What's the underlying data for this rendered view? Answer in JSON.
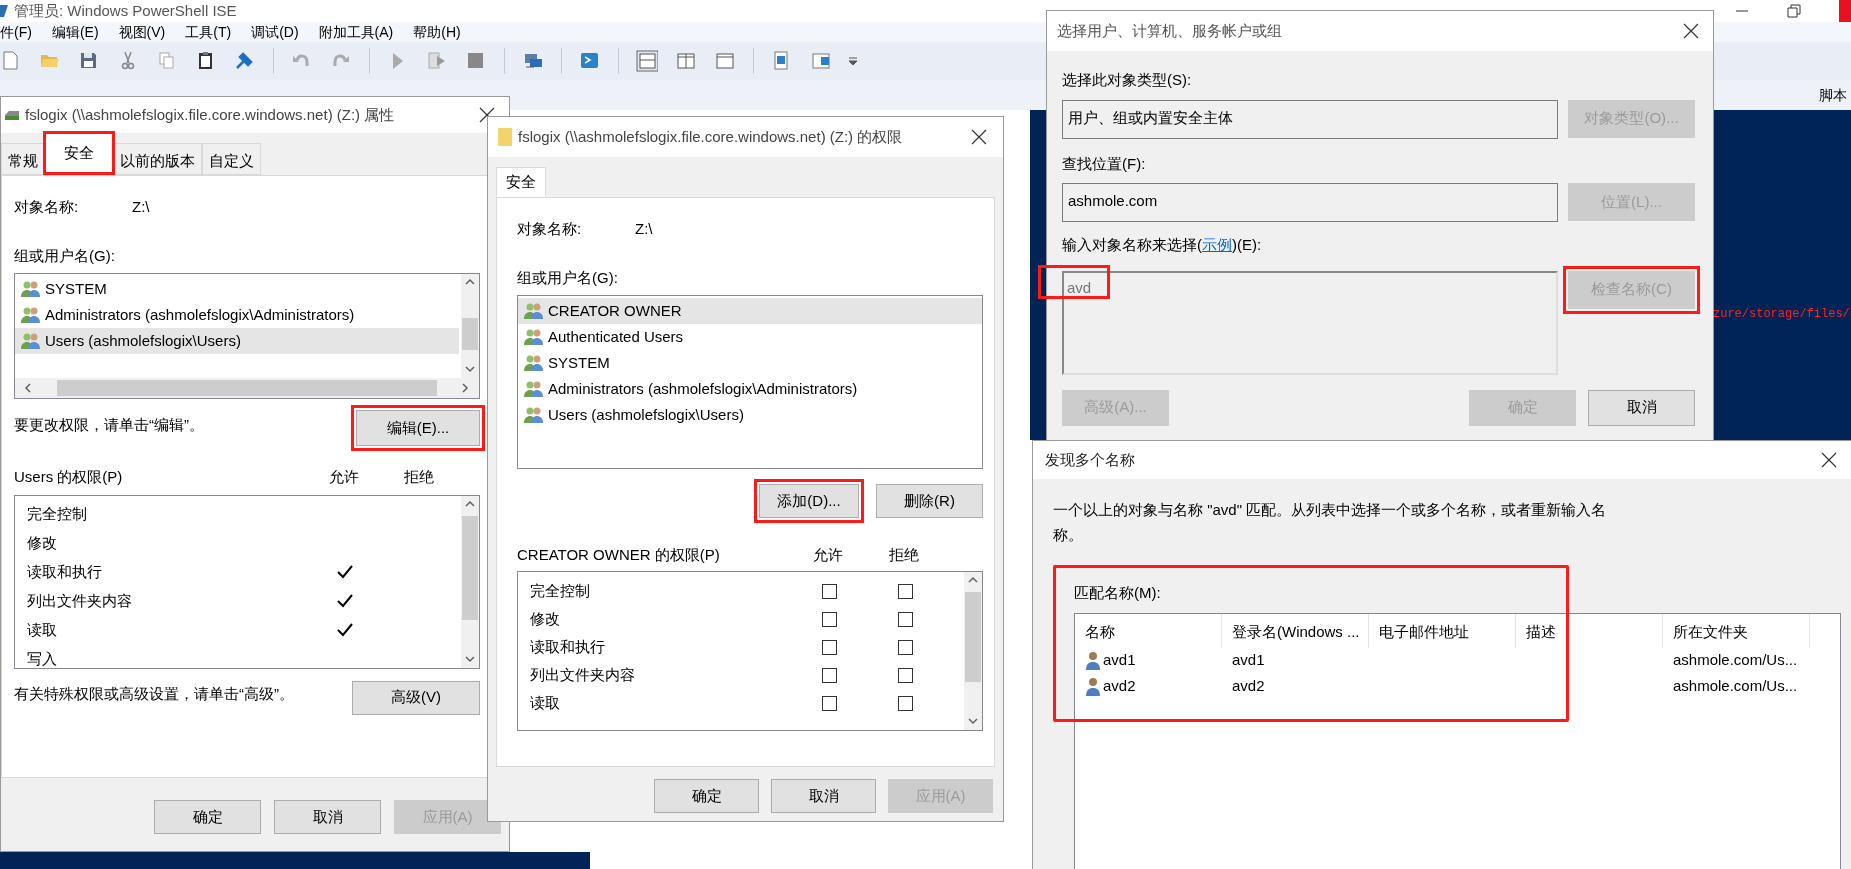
{
  "app": {
    "title": "管理员: Windows PowerShell ISE",
    "menu": [
      "件(F)",
      "编辑(E)",
      "视图(V)",
      "工具(T)",
      "调试(D)",
      "附加工具(A)",
      "帮助(H)"
    ],
    "pane_label": "脚本",
    "console_text": "zure/storage/files/"
  },
  "properties_dialog": {
    "title": "fslogix (\\\\ashmolefslogix.file.core.windows.net) (Z:) 属性",
    "tabs": [
      {
        "label": "常规",
        "selected": false,
        "highlighted": false
      },
      {
        "label": "安全",
        "selected": true,
        "highlighted": true
      },
      {
        "label": "以前的版本",
        "selected": false,
        "highlighted": false
      },
      {
        "label": "自定义",
        "selected": false,
        "highlighted": false
      }
    ],
    "object_label": "对象名称:",
    "object_value": "Z:\\",
    "groups_label": "组或用户名(G):",
    "groups": [
      {
        "name": "SYSTEM",
        "selected": false
      },
      {
        "name": "Administrators (ashmolefslogix\\Administrators)",
        "selected": false
      },
      {
        "name": "Users (ashmolefslogix\\Users)",
        "selected": true
      }
    ],
    "edit_hint": "要更改权限，请单击“编辑”。",
    "edit_button": {
      "label": "编辑(E)...",
      "highlighted": true
    },
    "permissions_label": "Users 的权限(P)",
    "allow_label": "允许",
    "deny_label": "拒绝",
    "permissions": [
      {
        "name": "完全控制",
        "allow": false
      },
      {
        "name": "修改",
        "allow": false
      },
      {
        "name": "读取和执行",
        "allow": true
      },
      {
        "name": "列出文件夹内容",
        "allow": true
      },
      {
        "name": "读取",
        "allow": true
      },
      {
        "name": "写入",
        "allow": false
      }
    ],
    "advanced_hint": "有关特殊权限或高级设置，请单击“高级”。",
    "advanced_button": "高级(V)",
    "buttons": [
      {
        "label": "确定",
        "disabled": false
      },
      {
        "label": "取消",
        "disabled": false
      },
      {
        "label": "应用(A)",
        "disabled": true
      }
    ]
  },
  "permissions_dialog": {
    "title": "fslogix (\\\\ashmolefslogix.file.core.windows.net) (Z:) 的权限",
    "tab": "安全",
    "object_label": "对象名称:",
    "object_value": "Z:\\",
    "groups_label": "组或用户名(G):",
    "groups": [
      {
        "name": "CREATOR OWNER",
        "selected": true
      },
      {
        "name": "Authenticated Users",
        "selected": false
      },
      {
        "name": "SYSTEM",
        "selected": false
      },
      {
        "name": "Administrators (ashmolefslogix\\Administrators)",
        "selected": false
      },
      {
        "name": "Users (ashmolefslogix\\Users)",
        "selected": false
      }
    ],
    "group_buttons": [
      {
        "label": "添加(D)...",
        "highlighted": true
      },
      {
        "label": "删除(R)",
        "highlighted": false
      }
    ],
    "permissions_label": "CREATOR OWNER 的权限(P)",
    "allow_label": "允许",
    "deny_label": "拒绝",
    "permissions": [
      {
        "name": "完全控制",
        "allow": false,
        "deny": false
      },
      {
        "name": "修改",
        "allow": false,
        "deny": false
      },
      {
        "name": "读取和执行",
        "allow": false,
        "deny": false
      },
      {
        "name": "列出文件夹内容",
        "allow": false,
        "deny": false
      },
      {
        "name": "读取",
        "allow": false,
        "deny": false
      }
    ],
    "buttons": [
      {
        "label": "确定",
        "disabled": false
      },
      {
        "label": "取消",
        "disabled": false
      },
      {
        "label": "应用(A)",
        "disabled": true
      }
    ]
  },
  "select_dialog": {
    "title": "选择用户、计算机、服务帐户或组",
    "type_label": "选择此对象类型(S):",
    "type_value": "用户、组或内置安全主体",
    "type_button": {
      "label": "对象类型(O)...",
      "disabled": true,
      "highlighted": false
    },
    "location_label": "查找位置(F):",
    "location_value": "ashmole.com",
    "location_button": {
      "label": "位置(L)...",
      "disabled": true,
      "highlighted": false
    },
    "names_label_before": "输入对象名称来选择(",
    "names_label_link": "示例",
    "names_label_after": ")(E):",
    "names_value": "avd",
    "names_disabled": true,
    "names_highlighted": true,
    "check_button": {
      "label": "检查名称(C)",
      "disabled": true,
      "highlighted": true
    },
    "buttons": [
      {
        "label": "高级(A)...",
        "disabled": true
      },
      {
        "label": "确定",
        "disabled": true
      },
      {
        "label": "取消",
        "disabled": false
      }
    ]
  },
  "matches_dialog": {
    "title": "发现多个名称",
    "message": "一个以上的对象与名称 \"avd\" 匹配。从列表中选择一个或多个名称，或者重新输入名称。",
    "highlighted": true,
    "list_label": "匹配名称(M):",
    "columns": [
      "名称",
      "登录名(Windows ...",
      "电子邮件地址",
      "描述",
      "所在文件夹"
    ],
    "rows": [
      {
        "name": "avd1",
        "login": "avd1",
        "folder": "ashmole.com/Us..."
      },
      {
        "name": "avd2",
        "login": "avd2",
        "folder": "ashmole.com/Us..."
      }
    ]
  }
}
